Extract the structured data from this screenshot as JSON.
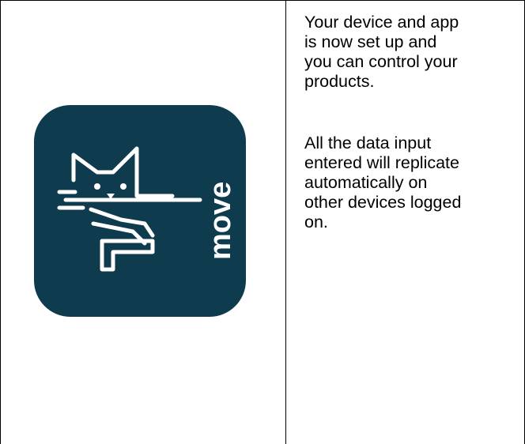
{
  "document": {
    "paragraph_1": [
      "Your device and app",
      "is now set up and",
      "you can control your",
      "products."
    ],
    "paragraph_2": [
      "All the data input",
      "entered will replicate",
      "automatically on",
      "other devices logged",
      "on."
    ]
  },
  "app_icon": {
    "icon_name": "move-cat-app-icon",
    "brand_text": "move",
    "background_color": "#0e3b4e",
    "foreground_color": "#ffffff"
  }
}
